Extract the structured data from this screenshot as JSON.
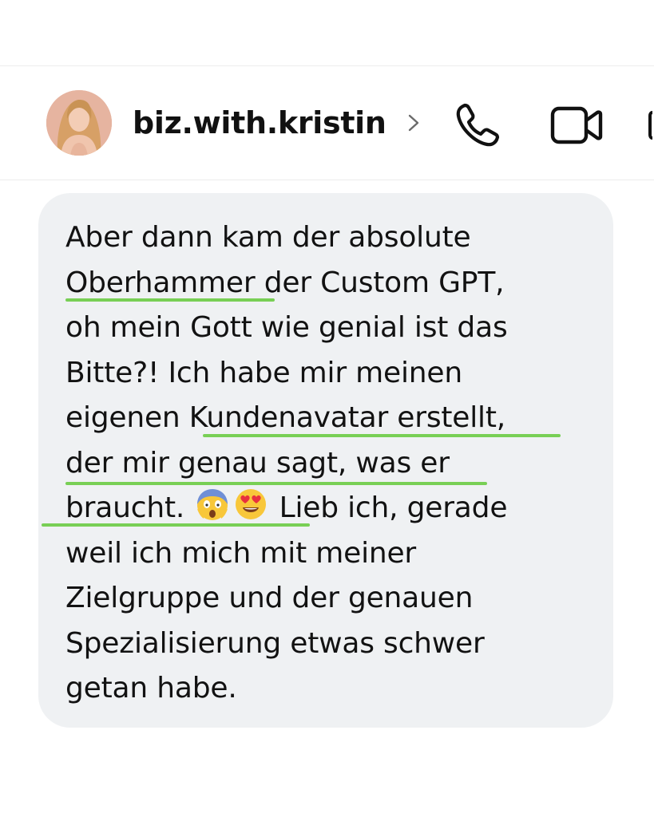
{
  "header": {
    "username": "biz.with.kristin",
    "avatar_icon": "profile-photo",
    "chevron_icon": "chevron-right-icon",
    "call_icon": "phone-icon",
    "video_icon": "video-camera-icon"
  },
  "message": {
    "lines": [
      "Aber dann kam der absolute",
      "Oberhammer der Custom GPT,",
      "oh mein Gott wie genial ist das",
      "Bitte?! Ich habe mir meinen",
      "eigenen Kundenavatar erstellt,",
      "der mir genau sagt, was er",
      "braucht.",
      "Lieb ich, gerade",
      "weil ich mich mit meiner",
      "Zielgruppe und der genauen",
      "Spezialisierung etwas schwer",
      "getan habe."
    ],
    "emoji_1": "😱",
    "emoji_2": "😍",
    "highlight_color": "#78cf55",
    "bubble_color": "#eff1f3"
  }
}
